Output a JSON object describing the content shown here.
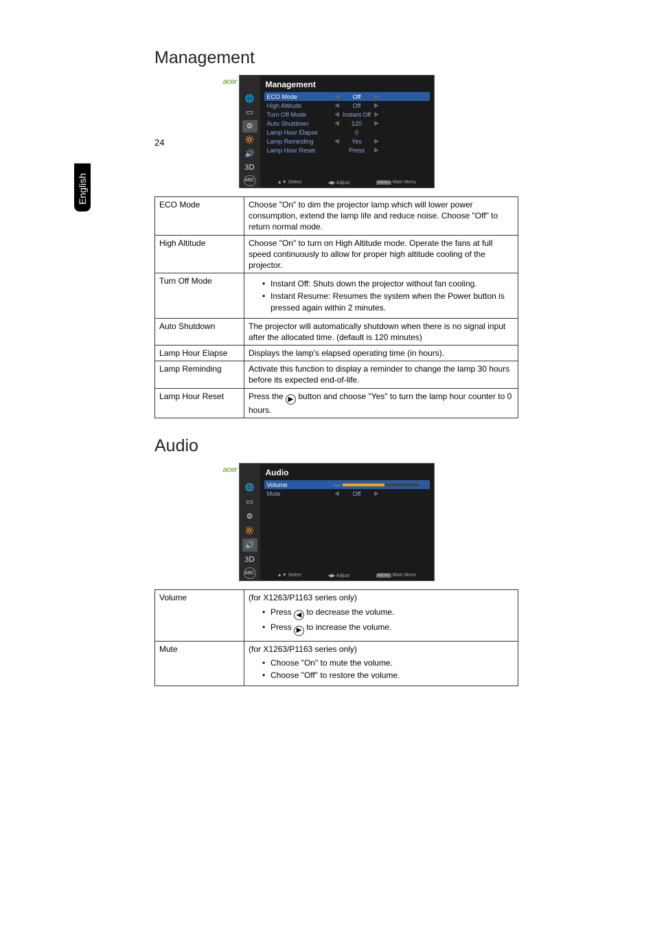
{
  "page_number": "24",
  "side_label": "English",
  "brand": "acer",
  "management": {
    "heading": "Management",
    "screenshot": {
      "title": "Management",
      "rows": [
        {
          "label": "ECO Mode",
          "value": "Off",
          "left": "◀",
          "right": "▶",
          "selected": true
        },
        {
          "label": "High Altitude",
          "value": "Off",
          "left": "◀",
          "right": "▶"
        },
        {
          "label": "Turn Off Mode",
          "value": "Instant Off",
          "left": "◀",
          "right": "▶"
        },
        {
          "label": "Auto Shutdown",
          "value": "120",
          "left": "◀",
          "right": "▶"
        },
        {
          "label": "Lamp Hour Elapse",
          "value": "0",
          "left": "",
          "right": ""
        },
        {
          "label": "Lamp Reminding",
          "value": "Yes",
          "left": "◀",
          "right": "▶"
        },
        {
          "label": "Lamp Hour Reset",
          "value": "Press",
          "left": "",
          "right": "▶"
        }
      ],
      "footer": {
        "select": "Select",
        "adjust": "Adjust",
        "menu": "Main Menu",
        "menu_key": "MENU"
      }
    },
    "table": {
      "eco_mode": {
        "label": "ECO Mode",
        "desc": "Choose \"On\" to dim the projector lamp which will lower power consumption, extend the lamp life and reduce noise.  Choose \"Off\" to return normal mode."
      },
      "high_altitude": {
        "label": "High Altitude",
        "desc": "Choose \"On\" to turn on High Altitude mode. Operate the fans at full speed continuously to allow for proper high altitude cooling of the projector."
      },
      "turn_off_mode": {
        "label": "Turn Off Mode",
        "b1": "Instant Off: Shuts down the projector without fan cooling.",
        "b2": "Instant Resume: Resumes the system when the Power button is pressed again within 2 minutes."
      },
      "auto_shutdown": {
        "label": "Auto Shutdown",
        "desc": "The projector will automatically shutdown when there is no signal input after the allocated time. (default is 120 minutes)"
      },
      "lamp_hour_elapse": {
        "label": "Lamp Hour Elapse",
        "desc": "Displays the lamp's elapsed operating time (in hours)."
      },
      "lamp_reminding": {
        "label": "Lamp Reminding",
        "desc": "Activate this function to display a reminder to change the lamp 30 hours before its expected end-of-life."
      },
      "lamp_hour_reset": {
        "label": "Lamp Hour Reset",
        "pre": "Press the ",
        "post": " button and choose \"Yes\" to turn the lamp hour counter to 0 hours."
      }
    }
  },
  "audio": {
    "heading": "Audio",
    "screenshot": {
      "title": "Audio",
      "rows": [
        {
          "label": "Volume",
          "type": "bar",
          "fill": "55%",
          "selected": true
        },
        {
          "label": "Mute",
          "value": "Off",
          "left": "◀",
          "right": "▶"
        }
      ],
      "footer": {
        "select": "Select",
        "adjust": "Adjust",
        "menu": "Main Menu",
        "menu_key": "MENU"
      }
    },
    "table": {
      "volume": {
        "label": "Volume",
        "note": "(for X1263/P1163 series only)",
        "b1_pre": "Press ",
        "b1_post": " to decrease the volume.",
        "b2_pre": "Press ",
        "b2_post": " to increase the volume."
      },
      "mute": {
        "label": "Mute",
        "note": "(for X1263/P1163 series only)",
        "b1": "Choose \"On\" to mute the volume.",
        "b2": "Choose \"Off\" to restore the volume."
      }
    }
  }
}
